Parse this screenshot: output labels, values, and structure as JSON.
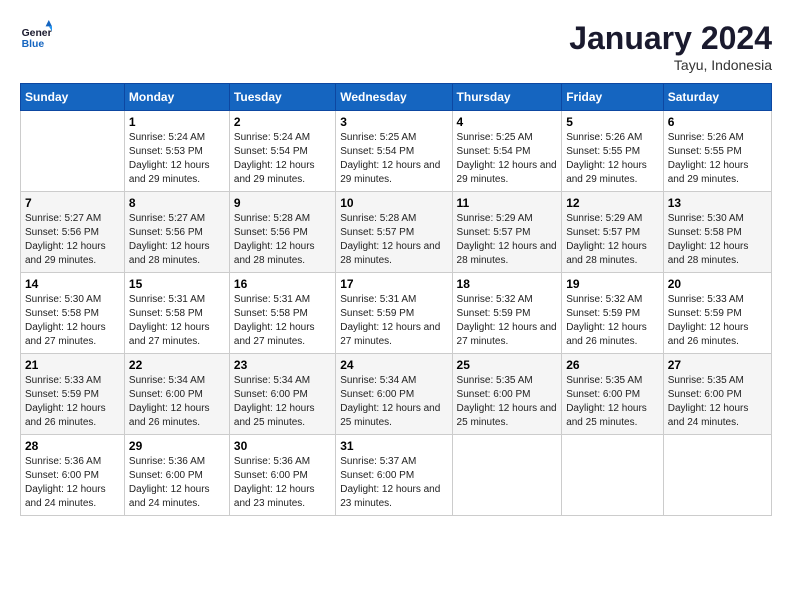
{
  "logo": {
    "line1": "General",
    "line2": "Blue"
  },
  "title": "January 2024",
  "subtitle": "Tayu, Indonesia",
  "days_of_week": [
    "Sunday",
    "Monday",
    "Tuesday",
    "Wednesday",
    "Thursday",
    "Friday",
    "Saturday"
  ],
  "weeks": [
    [
      {
        "num": "",
        "sunrise": "",
        "sunset": "",
        "daylight": ""
      },
      {
        "num": "1",
        "sunrise": "Sunrise: 5:24 AM",
        "sunset": "Sunset: 5:53 PM",
        "daylight": "Daylight: 12 hours and 29 minutes."
      },
      {
        "num": "2",
        "sunrise": "Sunrise: 5:24 AM",
        "sunset": "Sunset: 5:54 PM",
        "daylight": "Daylight: 12 hours and 29 minutes."
      },
      {
        "num": "3",
        "sunrise": "Sunrise: 5:25 AM",
        "sunset": "Sunset: 5:54 PM",
        "daylight": "Daylight: 12 hours and 29 minutes."
      },
      {
        "num": "4",
        "sunrise": "Sunrise: 5:25 AM",
        "sunset": "Sunset: 5:54 PM",
        "daylight": "Daylight: 12 hours and 29 minutes."
      },
      {
        "num": "5",
        "sunrise": "Sunrise: 5:26 AM",
        "sunset": "Sunset: 5:55 PM",
        "daylight": "Daylight: 12 hours and 29 minutes."
      },
      {
        "num": "6",
        "sunrise": "Sunrise: 5:26 AM",
        "sunset": "Sunset: 5:55 PM",
        "daylight": "Daylight: 12 hours and 29 minutes."
      }
    ],
    [
      {
        "num": "7",
        "sunrise": "Sunrise: 5:27 AM",
        "sunset": "Sunset: 5:56 PM",
        "daylight": "Daylight: 12 hours and 29 minutes."
      },
      {
        "num": "8",
        "sunrise": "Sunrise: 5:27 AM",
        "sunset": "Sunset: 5:56 PM",
        "daylight": "Daylight: 12 hours and 28 minutes."
      },
      {
        "num": "9",
        "sunrise": "Sunrise: 5:28 AM",
        "sunset": "Sunset: 5:56 PM",
        "daylight": "Daylight: 12 hours and 28 minutes."
      },
      {
        "num": "10",
        "sunrise": "Sunrise: 5:28 AM",
        "sunset": "Sunset: 5:57 PM",
        "daylight": "Daylight: 12 hours and 28 minutes."
      },
      {
        "num": "11",
        "sunrise": "Sunrise: 5:29 AM",
        "sunset": "Sunset: 5:57 PM",
        "daylight": "Daylight: 12 hours and 28 minutes."
      },
      {
        "num": "12",
        "sunrise": "Sunrise: 5:29 AM",
        "sunset": "Sunset: 5:57 PM",
        "daylight": "Daylight: 12 hours and 28 minutes."
      },
      {
        "num": "13",
        "sunrise": "Sunrise: 5:30 AM",
        "sunset": "Sunset: 5:58 PM",
        "daylight": "Daylight: 12 hours and 28 minutes."
      }
    ],
    [
      {
        "num": "14",
        "sunrise": "Sunrise: 5:30 AM",
        "sunset": "Sunset: 5:58 PM",
        "daylight": "Daylight: 12 hours and 27 minutes."
      },
      {
        "num": "15",
        "sunrise": "Sunrise: 5:31 AM",
        "sunset": "Sunset: 5:58 PM",
        "daylight": "Daylight: 12 hours and 27 minutes."
      },
      {
        "num": "16",
        "sunrise": "Sunrise: 5:31 AM",
        "sunset": "Sunset: 5:58 PM",
        "daylight": "Daylight: 12 hours and 27 minutes."
      },
      {
        "num": "17",
        "sunrise": "Sunrise: 5:31 AM",
        "sunset": "Sunset: 5:59 PM",
        "daylight": "Daylight: 12 hours and 27 minutes."
      },
      {
        "num": "18",
        "sunrise": "Sunrise: 5:32 AM",
        "sunset": "Sunset: 5:59 PM",
        "daylight": "Daylight: 12 hours and 27 minutes."
      },
      {
        "num": "19",
        "sunrise": "Sunrise: 5:32 AM",
        "sunset": "Sunset: 5:59 PM",
        "daylight": "Daylight: 12 hours and 26 minutes."
      },
      {
        "num": "20",
        "sunrise": "Sunrise: 5:33 AM",
        "sunset": "Sunset: 5:59 PM",
        "daylight": "Daylight: 12 hours and 26 minutes."
      }
    ],
    [
      {
        "num": "21",
        "sunrise": "Sunrise: 5:33 AM",
        "sunset": "Sunset: 5:59 PM",
        "daylight": "Daylight: 12 hours and 26 minutes."
      },
      {
        "num": "22",
        "sunrise": "Sunrise: 5:34 AM",
        "sunset": "Sunset: 6:00 PM",
        "daylight": "Daylight: 12 hours and 26 minutes."
      },
      {
        "num": "23",
        "sunrise": "Sunrise: 5:34 AM",
        "sunset": "Sunset: 6:00 PM",
        "daylight": "Daylight: 12 hours and 25 minutes."
      },
      {
        "num": "24",
        "sunrise": "Sunrise: 5:34 AM",
        "sunset": "Sunset: 6:00 PM",
        "daylight": "Daylight: 12 hours and 25 minutes."
      },
      {
        "num": "25",
        "sunrise": "Sunrise: 5:35 AM",
        "sunset": "Sunset: 6:00 PM",
        "daylight": "Daylight: 12 hours and 25 minutes."
      },
      {
        "num": "26",
        "sunrise": "Sunrise: 5:35 AM",
        "sunset": "Sunset: 6:00 PM",
        "daylight": "Daylight: 12 hours and 25 minutes."
      },
      {
        "num": "27",
        "sunrise": "Sunrise: 5:35 AM",
        "sunset": "Sunset: 6:00 PM",
        "daylight": "Daylight: 12 hours and 24 minutes."
      }
    ],
    [
      {
        "num": "28",
        "sunrise": "Sunrise: 5:36 AM",
        "sunset": "Sunset: 6:00 PM",
        "daylight": "Daylight: 12 hours and 24 minutes."
      },
      {
        "num": "29",
        "sunrise": "Sunrise: 5:36 AM",
        "sunset": "Sunset: 6:00 PM",
        "daylight": "Daylight: 12 hours and 24 minutes."
      },
      {
        "num": "30",
        "sunrise": "Sunrise: 5:36 AM",
        "sunset": "Sunset: 6:00 PM",
        "daylight": "Daylight: 12 hours and 23 minutes."
      },
      {
        "num": "31",
        "sunrise": "Sunrise: 5:37 AM",
        "sunset": "Sunset: 6:00 PM",
        "daylight": "Daylight: 12 hours and 23 minutes."
      },
      {
        "num": "",
        "sunrise": "",
        "sunset": "",
        "daylight": ""
      },
      {
        "num": "",
        "sunrise": "",
        "sunset": "",
        "daylight": ""
      },
      {
        "num": "",
        "sunrise": "",
        "sunset": "",
        "daylight": ""
      }
    ]
  ]
}
